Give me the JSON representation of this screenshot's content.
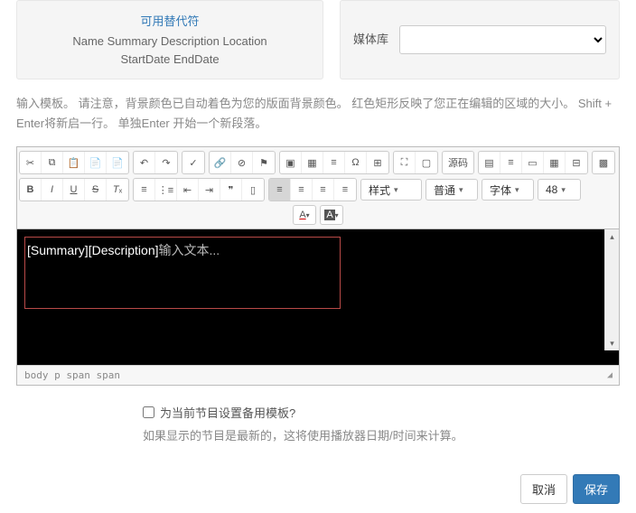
{
  "snippets": {
    "title": "可用替代符",
    "line1": "Name Summary Description Location",
    "line2": "StartDate EndDate"
  },
  "media": {
    "label": "媒体库"
  },
  "help_text": "输入模板。 请注意，背景颜色已自动着色为您的版面背景颜色。 红色矩形反映了您正在编辑的区域的大小。 Shift + Enter将新启一行。 单独Enter 开始一个新段落。",
  "toolbar": {
    "source": "源码",
    "format_label": "样式",
    "para_label": "普通",
    "font_label": "字体",
    "size_label": "48"
  },
  "content": {
    "summary": "[Summary]",
    "description": "[Description]",
    "placeholder": "输入文本..."
  },
  "status": {
    "path": "body  p  span  span"
  },
  "fallback": {
    "checkbox_label": "为当前节目设置备用模板?",
    "desc": "如果显示的节目是最新的，这将使用播放器日期/时间来计算。"
  },
  "actions": {
    "cancel": "取消",
    "save": "保存"
  }
}
